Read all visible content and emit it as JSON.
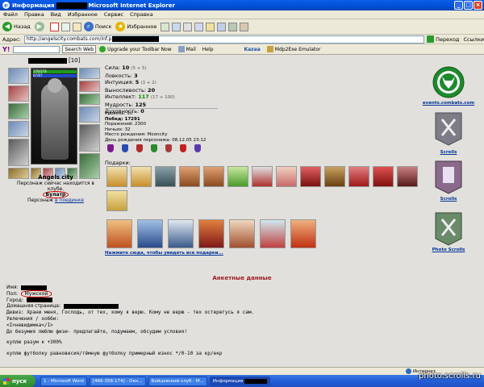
{
  "window": {
    "title_prefix": "Информация",
    "title_suffix": "Microsoft Internet Explorer"
  },
  "menu": [
    "Файл",
    "Правка",
    "Вид",
    "Избранное",
    "Сервис",
    "Справка"
  ],
  "toolbar": {
    "back": "Назад",
    "search": "Поиск",
    "favorites": "Избранное"
  },
  "address": {
    "label": "Адрес:",
    "url": "http://angelscity.combats.com/inf.p",
    "go": "Переход",
    "links": "Ссылки"
  },
  "yahoo": {
    "logo": "Y!",
    "search_button": "Search Web",
    "upgrade": "Upgrade your Toolbar Now",
    "mail": "Mail",
    "help": "Help",
    "kazaa": "Kazaa",
    "emulator": "Mdp2Exe Emulator"
  },
  "character": {
    "level": "[10]",
    "hp": "378/378",
    "mp": "67/67",
    "clan_name": "Angels city",
    "clan_line1": "Персонаж сейчас находится в клубе.",
    "clan_badge": "Булатр",
    "clan_line2_prefix": "Персонаж",
    "clan_line2_link": "в поединке"
  },
  "stats": {
    "strength_label": "Сила:",
    "strength": "10",
    "strength_bonus": "(5 + 5)",
    "agility_label": "Ловкость:",
    "agility": "3",
    "intuition_label": "Интуиция:",
    "intuition": "5",
    "intuition_bonus": "(3 + 2)",
    "endurance_label": "Выносливость:",
    "endurance": "20",
    "intellect_label": "Интеллект:",
    "intellect": "117",
    "intellect_bonus": "(17 + 100)",
    "wisdom_label": "Мудрость:",
    "wisdom": "125",
    "spirit_label": "Духовность:",
    "spirit": "0"
  },
  "extra": {
    "level": "Уровень: 10",
    "wins": "Побед: 17291",
    "losses": "Поражений: 2300",
    "draws": "Ничьих: 32",
    "birthplace": "Место рождения: Mooncity",
    "birthday": "День рождения персонажа: 08.12.05 23:12"
  },
  "gifts": {
    "label": "Подарки:",
    "more_link": "Нажмите сюда, чтобы увидеть все подарки..."
  },
  "sidebar": {
    "events": "events.combats.com",
    "scrolls": "Scrolls",
    "photo_scrolls": "Photo Scrolls"
  },
  "anketa": {
    "title": "Анкетные данные",
    "name_label": "Имя:",
    "gender_label": "Пол:",
    "gender_value": "Мужской",
    "city_label": "Город:",
    "homepage_label": "Домашняя страница:",
    "motto": "Девиз: Храни меня, Господь, от тех, кому я верю. Кому не верю - тех остерегусь я сам.",
    "hobby_label": "Увлечения / хобби:",
    "hobby_line1": "<I>невидимка</I>",
    "hobby_line2": "До безумия люблю физи- предлагайте, подумаем, обсудим условия!",
    "line3": "куплю разум к +300%",
    "line4": "куплю футболку равновесия/тёмную футболку примерный износ */0-10 за кр/екр"
  },
  "status": {
    "left": "",
    "zone": "Интернет"
  },
  "taskbar": {
    "start": "пуск",
    "task1": "1 - Microsoft Word",
    "task2": "[466-358-174] - Окн...",
    "task3": "Бойцовский клуб - M...",
    "task4": "Информация",
    "watermark": "photo.scrolls.ru"
  }
}
